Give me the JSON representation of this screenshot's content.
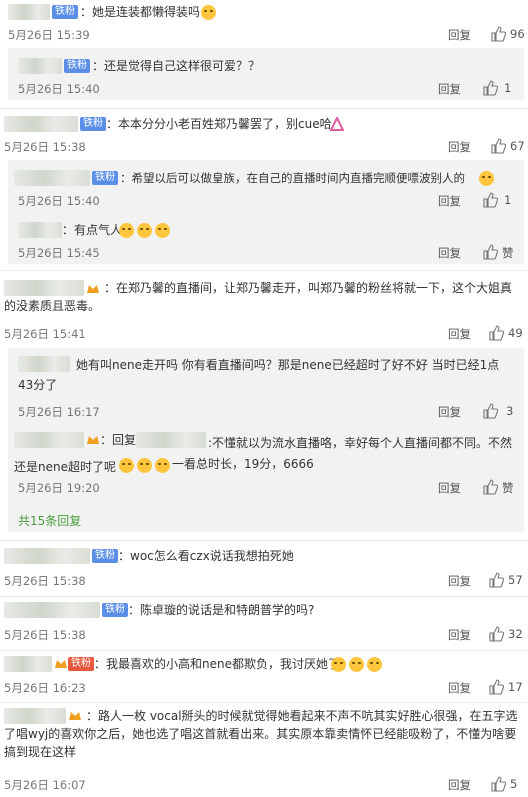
{
  "colors": {
    "badge": "#5b8ee6",
    "more_link": "#4a9e3e",
    "text": "#333333",
    "time": "#777777",
    "inner_bg": "#f2f2f2"
  },
  "comments": [
    {
      "badge": "铁粉",
      "text": "：她是连装都懒得装吗",
      "time": "5月26日 15:39",
      "reply": "回复",
      "likes": "96"
    },
    {
      "badge": "铁粉",
      "text": "：还是觉得自己这样很可爱？？",
      "time": "5月26日 15:40",
      "reply": "回复",
      "likes": "1"
    },
    {
      "badge": "铁粉",
      "text": "：本本分分小老百姓郑乃馨罢了，别cue哈",
      "time": "5月26日 15:38",
      "reply": "回复",
      "likes": "67"
    },
    {
      "badge": "铁粉",
      "text": "：希望以后可以做皇族，在自己的直播时间内直播完顺便嘌波别人的",
      "time": "5月26日 15:40",
      "reply": "回复",
      "likes": "1"
    },
    {
      "text": "：有点气人",
      "time": "5月26日 15:45",
      "reply": "回复",
      "likes": "赞"
    },
    {
      "text": "：在郑乃馨的直播间，让郑乃馨走开，叫郑乃馨的粉丝将就一下，这个大姐真的没素质且恶毒。",
      "time": "5月26日 15:41",
      "reply": "回复",
      "likes": "49"
    },
    {
      "text": "她有叫nene走开吗  你有看直播间吗？那是nene已经超时了好不好 当时已经1点43分了",
      "time": "5月26日 16:17",
      "reply": "回复",
      "likes": "3"
    },
    {
      "prefix": "：回复",
      "text": ":不懂就以为流水直播咯，幸好每个人直播间都不同。不然还是nene超时了呢",
      "text2": "一看总时长，19分，6666",
      "time": "5月26日 19:20",
      "reply": "回复",
      "likes": "赞"
    },
    {
      "more": "共15条回复"
    },
    {
      "badge": "铁粉",
      "text": "：woc怎么看czx说话我想拍死她",
      "time": "5月26日 15:38",
      "reply": "回复",
      "likes": "57"
    },
    {
      "badge": "铁粉",
      "text": "：陈卓璇的说话是和特朗普学的吗?",
      "time": "5月26日 15:38",
      "reply": "回复",
      "likes": "32"
    },
    {
      "badge": "铁粉",
      "text": "：我最喜欢的小高和nene都欺负，我讨厌她了",
      "time": "5月26日 16:23",
      "reply": "回复",
      "likes": "17"
    },
    {
      "text": "：路人一枚 vocal掰头的时候就觉得她看起来不声不吭其实好胜心很强，在五字选了唱wyj的喜欢你之后，她也选了唱这首就看出来。其实原本靠卖情怀已经能吸粉了，不懂为啥要搞到现在这样",
      "time": "5月26日 16:07",
      "reply": "回复",
      "likes": "5"
    }
  ]
}
